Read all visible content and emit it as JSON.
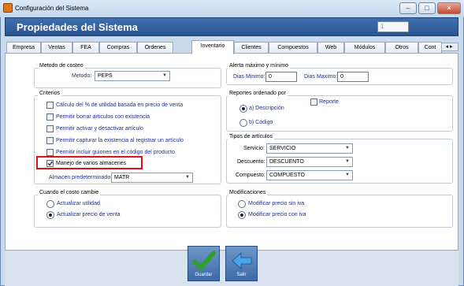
{
  "window": {
    "title": "Configuración del Sistema",
    "minimize": "–",
    "maximize": "□",
    "close": "×"
  },
  "header": {
    "title": "Propiedades del Sistema",
    "field_value": "1"
  },
  "tabs": [
    "Empresa",
    "Ventas",
    "FEA",
    "Compras",
    "Ordenes",
    "Inventario",
    "Clientes",
    "Compuestos",
    "Web",
    "Módulos",
    "Otros",
    "Cont"
  ],
  "active_tab": "Inventario",
  "tab_arrows": "◂▸",
  "costeo": {
    "group": "Metodo de costeo",
    "label": "Metodo:",
    "value": "PEPS"
  },
  "alerta": {
    "group": "Alerta máximo y mínimo",
    "min_label": "Dias Minimo:",
    "min_value": "0",
    "max_label": "Dias Maximo:",
    "max_value": "0"
  },
  "criterios": {
    "group": "Criterios",
    "items": [
      {
        "label": "Cálculo del % de utilidad basada en precio de venta",
        "checked": false
      },
      {
        "label": "Permitir borrar articulos con existencia",
        "checked": false
      },
      {
        "label": "Permitir activar y desactivar artículo",
        "checked": false
      },
      {
        "label": "Permitir capturar la existencia al registrar un artículo",
        "checked": false
      },
      {
        "label": "Permitir incluir guiones en el código del producto",
        "checked": false
      },
      {
        "label": "Manejo de varios almacenes",
        "checked": true
      }
    ],
    "almacen_label": "Almacen predeterminado:",
    "almacen_value": "MATR"
  },
  "reportes": {
    "group": "Reportes ordenado por",
    "option1": "a) Descripción",
    "option2": "b) Código",
    "reporte_label": "Reporte"
  },
  "tipos": {
    "group": "Tipos de artículos",
    "servicio_label": "Servicio:",
    "servicio_value": "SERVICIO",
    "descuento_label": "Descuento:",
    "descuento_value": "DESCUENTO",
    "compuesto_label": "Compuesto:",
    "compuesto_value": "COMPUESTO"
  },
  "costo": {
    "group": "Cuando el costo cambie",
    "option1": "Actualizar utilidad",
    "option2": "Actualizar precio de venta"
  },
  "modificaciones": {
    "group": "Modificaciones",
    "option1": "Modificar precio sin iva",
    "option2": "Modificar precio con iva"
  },
  "buttons": {
    "save": "Guardar",
    "exit": "Salir"
  },
  "colors": {
    "header": "#2f5f9e",
    "highlight": "#d6151a",
    "save_check": "#2fa02f"
  }
}
